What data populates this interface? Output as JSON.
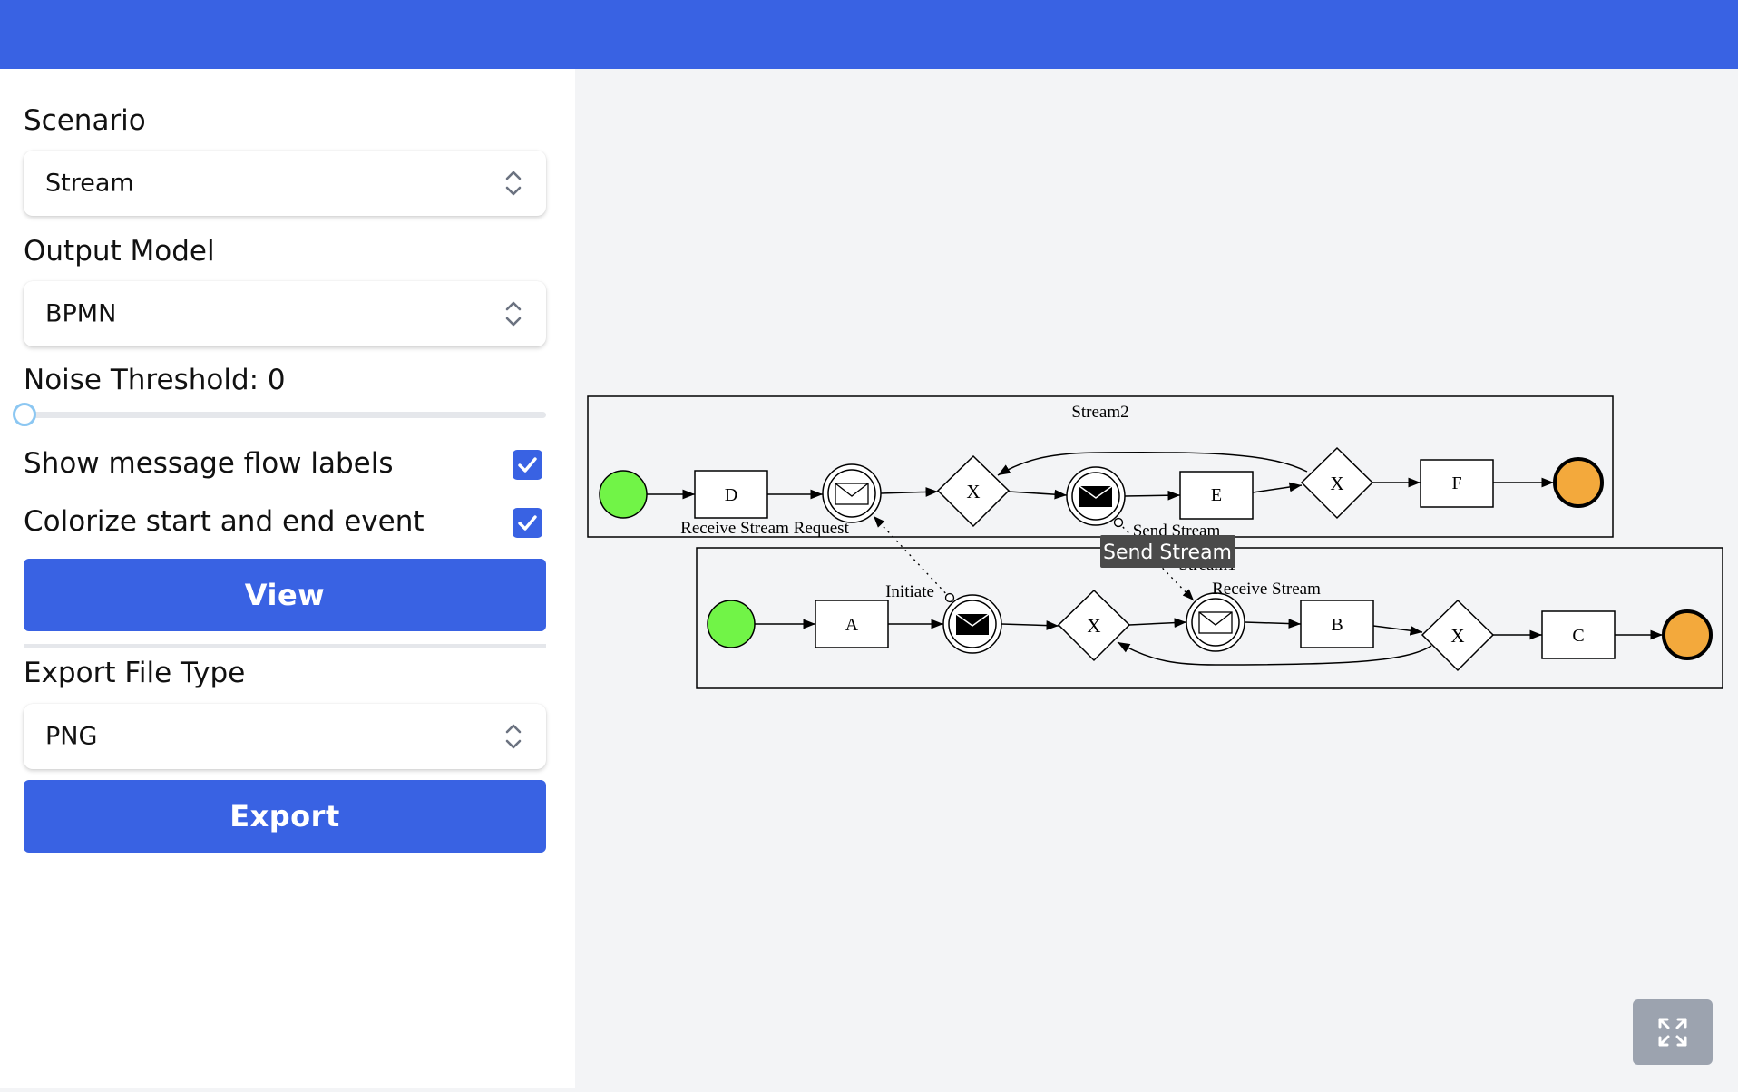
{
  "sidebar": {
    "scenario": {
      "label": "Scenario",
      "value": "Stream"
    },
    "output_model": {
      "label": "Output Model",
      "value": "BPMN"
    },
    "noise": {
      "label": "Noise Threshold: 0",
      "value": 0
    },
    "show_labels": {
      "label": "Show message flow labels",
      "checked": true
    },
    "colorize": {
      "label": "Colorize start and end event",
      "checked": true
    },
    "view_button": "View",
    "export_type": {
      "label": "Export File Type",
      "value": "PNG"
    },
    "export_button": "Export"
  },
  "diagram": {
    "pool_top": "Stream2",
    "pool_bottom": "Stream1",
    "tasks": {
      "d": "D",
      "e": "E",
      "f": "F",
      "a": "A",
      "b": "B",
      "c": "C"
    },
    "gateway_label": "X",
    "msg_labels": {
      "receive_request": "Receive Stream Request",
      "send_stream": "Send Stream",
      "initiate": "Initiate",
      "receive_stream": "Receive Stream"
    },
    "tooltip": "Send Stream",
    "colors": {
      "start": "#71f447",
      "end": "#f3a93c"
    }
  },
  "toolbar": {
    "fullscreen_icon": "expand-icon"
  }
}
